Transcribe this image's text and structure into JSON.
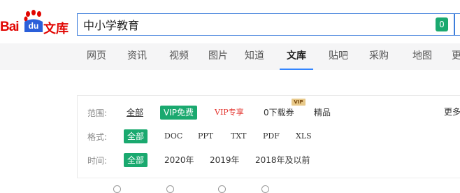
{
  "header": {
    "logo_bai": "Bai",
    "logo_du": "du",
    "logo_wenku": "文库",
    "search_value": "中小学教育",
    "badge_count": "0"
  },
  "nav": {
    "tabs": [
      {
        "label": "网页"
      },
      {
        "label": "资讯"
      },
      {
        "label": "视频"
      },
      {
        "label": "图片"
      },
      {
        "label": "知道"
      },
      {
        "label": "文库",
        "active": true
      },
      {
        "label": "贴吧"
      },
      {
        "label": "采购"
      },
      {
        "label": "地图"
      },
      {
        "label": "更"
      }
    ]
  },
  "filters": {
    "scope": {
      "label": "范围:",
      "options": [
        "全部",
        "VIP免费",
        "VIP专享",
        "0下载券",
        "精品"
      ],
      "vip_tag": "VIP"
    },
    "format": {
      "label": "格式:",
      "options": [
        "全部",
        "DOC",
        "PPT",
        "TXT",
        "PDF",
        "XLS"
      ]
    },
    "time": {
      "label": "时间:",
      "options": [
        "全部",
        "2020年",
        "2019年",
        "2018年及以前"
      ]
    },
    "more": "更多"
  },
  "colors": {
    "accent_green": "#1aa96f",
    "brand_red": "#e10602",
    "brand_blue": "#2b5fd9",
    "active_tab_blue": "#3385ff"
  }
}
